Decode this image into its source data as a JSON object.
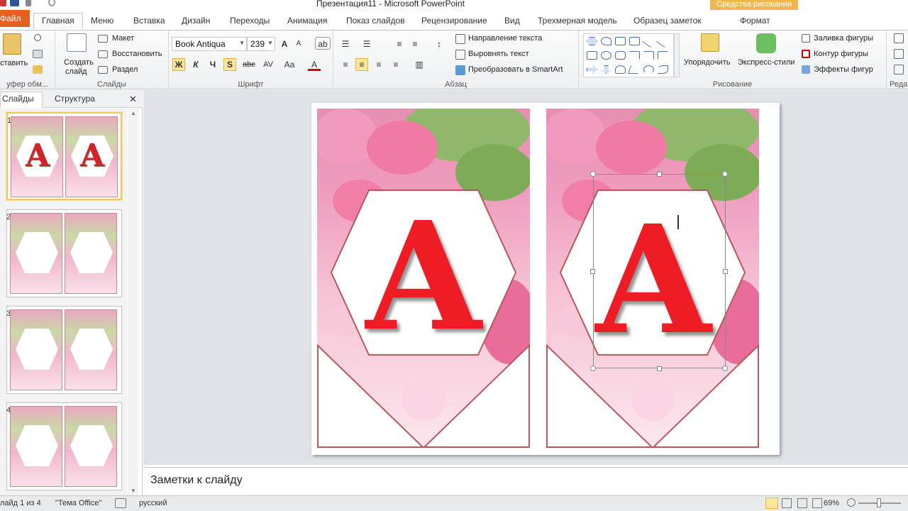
{
  "window": {
    "title": "Презентация11 - Microsoft PowerPoint"
  },
  "tabs": [
    "Файл",
    "Главная",
    "Меню",
    "Вставка",
    "Дизайн",
    "Переходы",
    "Анимация",
    "Показ слайдов",
    "Рецензирование",
    "Вид",
    "Трехмерная модель",
    "Образец заметок",
    "Формат"
  ],
  "contextual": {
    "header": "Средства рисования"
  },
  "ribbon": {
    "clipboard": {
      "paste": "ставить",
      "group": "уфер обм..."
    },
    "slides": {
      "new_slide_1": "Создать",
      "new_slide_2": "слайд",
      "layout": "Макет",
      "reset": "Восстановить",
      "section": "Раздел",
      "group": "Слайды"
    },
    "font": {
      "name": "Book Antiqua",
      "size": "239",
      "bold": "Ж",
      "italic": "К",
      "underline": "Ч",
      "shadow": "S",
      "strike": "abc",
      "spacing": "AV",
      "case": "Aa",
      "color": "A",
      "group": "Шрифт"
    },
    "paragraph": {
      "text_direction": "Направление текста",
      "align_text": "Выровнять текст",
      "smartart": "Преобразовать в SmartArt",
      "group": "Абзац"
    },
    "drawing": {
      "arrange": "Упорядочить",
      "quick_styles": "Экспресс-стили",
      "fill": "Заливка фигуры",
      "outline": "Контур фигуры",
      "effects": "Эффекты фигур",
      "group": "Рисование"
    },
    "editing": {
      "group": "Реда"
    }
  },
  "leftpane": {
    "tabs": [
      "Слайды",
      "Структура"
    ],
    "close": "✕",
    "slides": [
      {
        "number": "1",
        "letter": "A"
      },
      {
        "number": "2",
        "letter": ""
      },
      {
        "number": "3",
        "letter": ""
      },
      {
        "number": "4",
        "letter": ""
      }
    ]
  },
  "slide": {
    "letters": [
      "A",
      "A"
    ]
  },
  "notes": {
    "placeholder": "Заметки к слайду"
  },
  "status": {
    "slide_info": "лайд 1 из 4",
    "theme": "\"Тема Office\"",
    "language": "русский",
    "zoom": "69%"
  },
  "colors": {
    "letter": "#ee1c24",
    "hex_border": "#b5595b",
    "file_tab": "#e65f1e",
    "context_tab": "#f0b74c"
  }
}
